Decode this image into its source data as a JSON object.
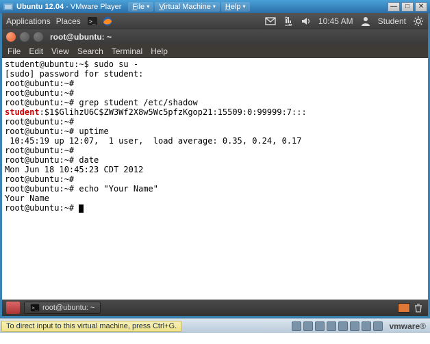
{
  "vmware": {
    "title_main": "Ubuntu 12.04",
    "title_sub": " - VMware Player",
    "menus": [
      "File",
      "Virtual Machine",
      "Help"
    ],
    "hint": "To direct input to this virtual machine, press Ctrl+G.",
    "brand": "vmware"
  },
  "ubuntu_panel": {
    "applications": "Applications",
    "places": "Places",
    "clock": "10:45 AM",
    "user": "Student"
  },
  "terminal": {
    "window_title": "root@ubuntu: ~",
    "menu": [
      "File",
      "Edit",
      "View",
      "Search",
      "Terminal",
      "Help"
    ],
    "lines": [
      {
        "text": "student@ubuntu:~$ sudo su -"
      },
      {
        "text": "[sudo] password for student:"
      },
      {
        "text": "root@ubuntu:~#"
      },
      {
        "text": "root@ubuntu:~#"
      },
      {
        "text": "root@ubuntu:~# grep student /etc/shadow"
      },
      {
        "red": "student",
        "text": ":$1$GlihzU6C$ZW3Wf2X8w5Wc5pfzKgop21:15509:0:99999:7:::"
      },
      {
        "text": "root@ubuntu:~#"
      },
      {
        "text": "root@ubuntu:~# uptime"
      },
      {
        "text": " 10:45:19 up 12:07,  1 user,  load average: 0.35, 0.24, 0.17"
      },
      {
        "text": "root@ubuntu:~#"
      },
      {
        "text": "root@ubuntu:~# date"
      },
      {
        "text": "Mon Jun 18 10:45:23 CDT 2012"
      },
      {
        "text": "root@ubuntu:~#"
      },
      {
        "text": "root@ubuntu:~# echo \"Your Name\""
      },
      {
        "text": "Your Name"
      },
      {
        "text": "root@ubuntu:~# ",
        "cursor": true
      }
    ]
  },
  "taskbar": {
    "task_title": "root@ubuntu: ~"
  }
}
